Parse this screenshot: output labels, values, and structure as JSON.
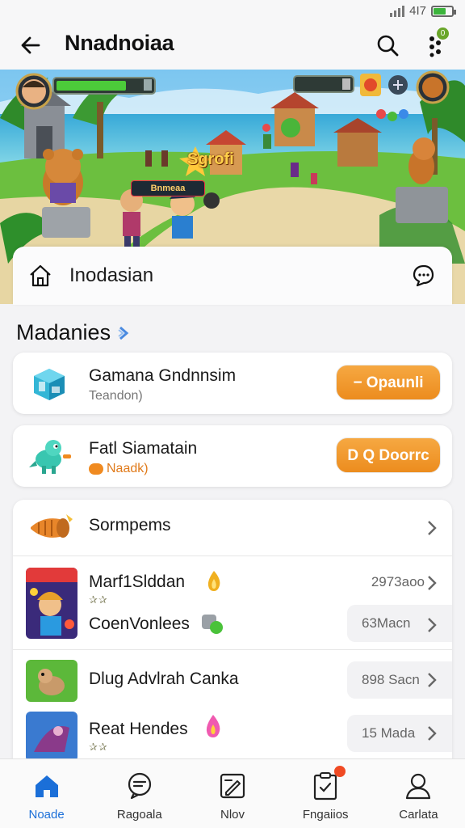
{
  "status_bar": {
    "signal_text": "4I7",
    "battery_level": 0.7,
    "colors": {
      "battery": "#3cb43c"
    }
  },
  "app_bar": {
    "title": "Nnadnoiaa",
    "menu_badge": "0",
    "icons": [
      "back-arrow-icon",
      "search-icon",
      "more-dots-icon"
    ]
  },
  "banner": {
    "label_tag": "Bnmeaa",
    "game_title": "Sgrofi",
    "home_label": "Inodasian",
    "icons": [
      "home-icon",
      "chat-icon"
    ]
  },
  "section": {
    "title": "Madanies",
    "icon": "chevron-right-icon"
  },
  "features": [
    {
      "name": "Gamana Gndnnsim",
      "subtitle": "Teandon)",
      "button": "− Opaunli",
      "icon": "isometric-cube-icon"
    },
    {
      "name": "Fatl Siamatain",
      "subtitle": "Naadk)",
      "button": "D Q Doorrc",
      "icon": "dino-icon"
    }
  ],
  "list": {
    "header": {
      "title": "Sormpems",
      "icon": "horn-icon"
    },
    "games": [
      {
        "name": "Marf1Slddan",
        "stars": "✰✰",
        "meta": "2973aoo"
      },
      {
        "name": "CoenVonlees",
        "stars": "",
        "meta": "63Macn"
      },
      {
        "name": "Dlug Advlrah Canka",
        "stars": "",
        "meta": "898 Sacn"
      },
      {
        "name": "Reat Hendes",
        "stars": "✰✰",
        "meta": "15 Mada"
      }
    ]
  },
  "bottom_nav": [
    {
      "label": "Noade",
      "icon": "home-filled-icon",
      "active": true
    },
    {
      "label": "Ragoala",
      "icon": "chat-bubble-icon",
      "active": false
    },
    {
      "label": "Nlov",
      "icon": "edit-note-icon",
      "active": false
    },
    {
      "label": "Fngaiios",
      "icon": "clipboard-check-icon",
      "active": false
    },
    {
      "label": "Carlata",
      "icon": "person-icon",
      "active": false
    }
  ],
  "colors": {
    "accent": "#1b6fd8",
    "button_orange": "#ec8c1e",
    "badge_red": "#f04a23"
  }
}
